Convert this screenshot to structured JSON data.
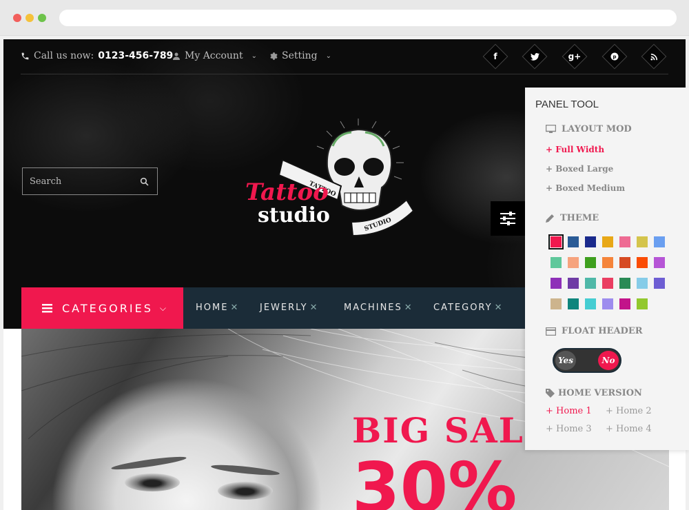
{
  "topbar": {
    "call_label": "Call us now:",
    "phone": "0123-456-789",
    "account_label": "My Account",
    "setting_label": "Setting",
    "social": [
      "f",
      "t",
      "g+",
      "p",
      "rss"
    ]
  },
  "search": {
    "placeholder": "Search"
  },
  "logo": {
    "line1": "Tattoo",
    "line2": "studio",
    "ribbon_left": "TATTOO",
    "ribbon_right": "STUDIO"
  },
  "nav": {
    "categories_label": "CATEGORIES",
    "items": [
      "HOME",
      "JEWERLY",
      "MACHINES",
      "CATEGORY"
    ]
  },
  "banner": {
    "headline": "BIG SALE",
    "percent": "30%"
  },
  "panel": {
    "title": "PANEL TOOL",
    "layout": {
      "heading": "LAYOUT MOD",
      "options": [
        "+ Full Width",
        "+ Boxed Large",
        "+ Boxed Medium"
      ]
    },
    "theme": {
      "heading": "THEME",
      "colors": [
        "#f0184e",
        "#2a5b96",
        "#1a2a8c",
        "#e8a817",
        "#ee6b93",
        "#d4c44c",
        "#6a9ff0",
        "#5fc89b",
        "#f6a37e",
        "#3e9f1e",
        "#f5843a",
        "#d64a22",
        "#fb4c05",
        "#b655d6",
        "#8e30b8",
        "#6f3ca5",
        "#4fb8a8",
        "#ea3e62",
        "#2a8a55",
        "#86cce8",
        "#6e5ed3",
        "#cdb48d",
        "#0e857c",
        "#45cdd2",
        "#9d8cee",
        "#c2148a",
        "#92c82e"
      ]
    },
    "float_header": {
      "heading": "FLOAT HEADER",
      "yes": "Yes",
      "no": "No"
    },
    "home_version": {
      "heading": "HOME VERSION",
      "options": [
        "Home 1",
        "Home 2",
        "Home 3",
        "Home 4"
      ]
    }
  }
}
